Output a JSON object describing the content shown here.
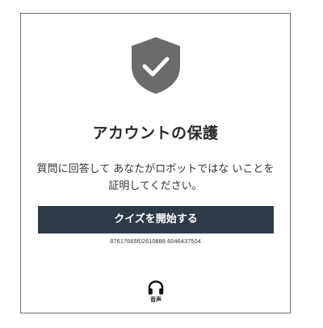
{
  "dialog": {
    "title": "アカウントの保護",
    "description": "質問に回答して あなたがロボットではな いことを証明してください。",
    "start_button_label": "クイズを開始する",
    "session_id": "87617665f02610888.6046437504",
    "audio_label": "音声"
  },
  "colors": {
    "shield": "#6b6b6b",
    "button_bg": "#2f3a47",
    "button_text": "#ffffff",
    "title": "#2a2a2a"
  },
  "icons": {
    "shield": "shield-check-icon",
    "audio": "headphones-icon"
  }
}
